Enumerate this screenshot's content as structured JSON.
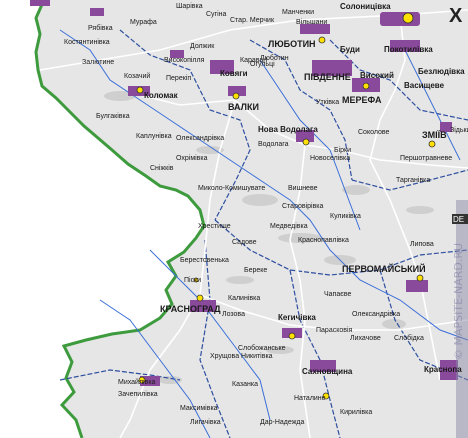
{
  "map": {
    "colors": {
      "outside": "#ffffff",
      "land": "#e6e6e6",
      "oblast_border": "#3d9b3d",
      "district_border": "#2e4fa0",
      "roads": "#ffffff",
      "rivers": "#3b6fd8",
      "settlement": "#8a4a9c",
      "forest": "#cfcfcf",
      "city_marker": "#ffe000"
    },
    "labels": {
      "kharkiv_letter": "Х",
      "solonytsivka": "Солоницівка",
      "vilshany": "Вільшани",
      "liubotyn": "ЛЮБОТИН",
      "budy": "Буди",
      "pokotylivka": "Покотилівка",
      "pivdenne": "ПІВДЕННЕ",
      "vysokyi": "Високий",
      "bezliudivka": "Безлюдівка",
      "merefa": "МЕРЕФА",
      "vasyshcheve": "Васищеве",
      "kovyahy": "Ковяги",
      "valky": "ВАЛКИ",
      "kolomak": "Коломак",
      "kostiantynivka": "Костянтинівка",
      "murafa": "Мурафа",
      "star_merchyk": "Стар. Мерчик",
      "mankhenky": "Манченки",
      "nova_vodolaha": "Нова Водолага",
      "birky": "Бірки",
      "zmiiv": "ЗМІЇВ",
      "zidky": "Зідьки",
      "utkivka": "Утківка",
      "novoselivka": "Новоселівка",
      "starovirivka": "Старовірівка",
      "okhrimivka": "Охрімівка",
      "snizhkiv": "Сніжків",
      "kaplunivka": "Каплунівка",
      "mykola_komyshuvate": "Миколо-Комишувате",
      "khrestyshche": "Хрестище",
      "berestovenka": "Берестовенька",
      "pisky": "Піски",
      "krasnohrad": "КРАСНОГРАД",
      "pershotravneve": "Першотравневе",
      "tarhanivka": "Тарганівка",
      "pervomaiskyi": "ПЕРВОМАЙСЬКИЙ",
      "chapaieve": "Чапаєве",
      "kehychivka": "Кегичівка",
      "sakhnovshchyna": "Сахновщина",
      "natalyne": "Наталине",
      "zachepylivka": "Зачепилівка",
      "mykhailivka": "Михайлівка",
      "kazanka": "Казанка",
      "kegychivka_small": "Слобожанське",
      "medvedivka": "Медведівка",
      "krasnopavlivka": "Краснопавлівка",
      "lykhachove": "Лихачове",
      "krasnoh_right": "Краснопа",
      "de_tag": "DE",
      "vodop": "Водолага",
      "olekssandrivka": "Олександрівка",
      "dolzhyk": "Должик",
      "karavan": "Караван",
      "paraskovia": "Парасковія",
      "lozova_left": "Лозова",
      "dar_nadezhda": "Дар-Надежда",
      "liubotyn_region": "Люботин",
      "zaliutyne": "Залютине",
      "mosk": "Козачий",
      "sokolove": "Соколове",
      "dolzhik2": "Вишневе",
      "kulykivka": "Куликівка",
      "khrushchova": "Хрущова Никитівка",
      "kilkivka": "Кирилівка",
      "sharivka": "Шарівка",
      "sukhyn": "Сугіна",
      "vysopillia": "Високопілля",
      "bulhakivka": "Булгаківка",
      "perekip": "Перекіп",
      "ryabovka": "Рябівка",
      "sadove": "Садове",
      "oleksandrivka2": "Олександрівка",
      "ogultsi": "Огульці",
      "kalynivka": "Калинівка",
      "maksymivka": "Максимівка",
      "lihachovka": "Лигачівка",
      "bereka": "Береке",
      "lyhova": "Липова",
      "slob": "Слобідка"
    },
    "watermark": "© MAPSITE-NARD.RU"
  }
}
